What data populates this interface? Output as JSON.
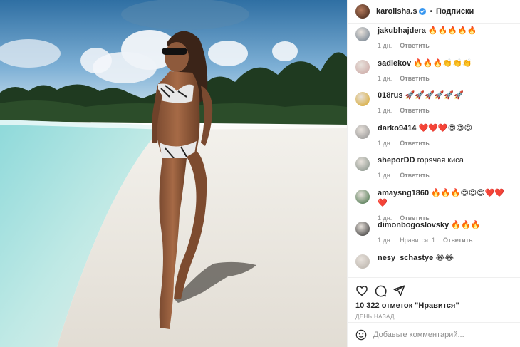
{
  "header": {
    "username": "karolisha.s",
    "dot": "•",
    "follow_label": "Подписки"
  },
  "comments": [
    {
      "user": "jakubhajdera",
      "text": "🔥🔥🔥🔥🔥",
      "time": "1 дн.",
      "likes": "",
      "reply": "Ответить",
      "avatar_color": "#6b7b8a"
    },
    {
      "user": "sadiekov",
      "text": "🔥🔥🔥👏👏👏",
      "time": "1 дн.",
      "likes": "",
      "reply": "Ответить",
      "avatar_color": "#c9a3a0"
    },
    {
      "user": "018rus",
      "text": "🚀🚀🚀🚀🚀🚀",
      "time": "1 дн.",
      "likes": "",
      "reply": "Ответить",
      "avatar_color": "#d6a321"
    },
    {
      "user": "darko9414",
      "text": "❤️❤️❤️😍😍😍",
      "time": "1 дн.",
      "likes": "",
      "reply": "Ответить",
      "avatar_color": "#8e8e8e"
    },
    {
      "user": "sheporDD",
      "text": "горячая киса",
      "time": "1 дн.",
      "likes": "",
      "reply": "Ответить",
      "avatar_color": "#7f8c83"
    },
    {
      "user": "amaysng1860",
      "text": "🔥🔥🔥😍😍😍❤️❤️❤️",
      "time": "1 дн.",
      "likes": "",
      "reply": "Ответить",
      "avatar_color": "#3b6b3e"
    },
    {
      "user": "dimonbogoslovsky",
      "text": "🔥🔥🔥",
      "time": "1 дн.",
      "likes": "Нравится: 1",
      "reply": "Ответить",
      "avatar_color": "#2b2b2b"
    },
    {
      "user": "nesy_schastye",
      "text": "😂😂",
      "time": "",
      "likes": "",
      "reply": "",
      "avatar_color": "#b7b0a8"
    }
  ],
  "actions": {
    "likes_text": "10 322 отметок \"Нравится\"",
    "date_text": "ДЕНЬ НАЗАД"
  },
  "add_comment": {
    "placeholder": "Добавьте комментарий..."
  },
  "icons": {
    "like": "heart-icon",
    "comment": "comment-icon",
    "share": "share-icon",
    "emoji": "smile-icon",
    "verified": "verified-icon"
  },
  "colors": {
    "sea": "#7fd0d4",
    "sand": "#ece8e1",
    "sky": "#3a84b8",
    "text": "#262626",
    "muted": "#8e8e8e",
    "verified": "#3897f0"
  }
}
